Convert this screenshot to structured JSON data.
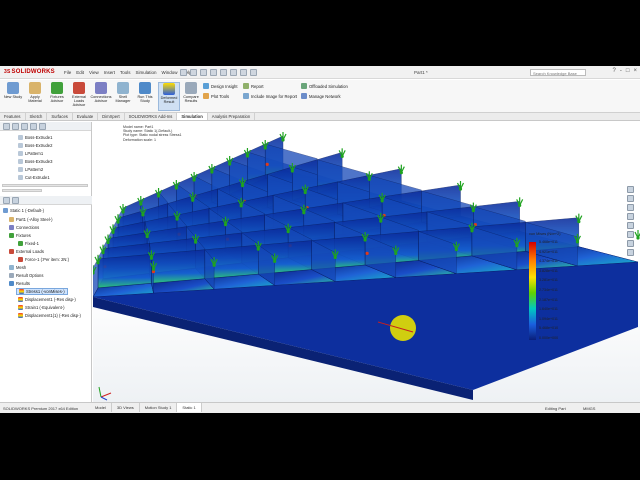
{
  "app": {
    "logo_prefix": "3S",
    "logo": "SOLIDWORKS",
    "title": "Part1 *",
    "search_placeholder": "Search Knowledge Base",
    "window_buttons": [
      "?",
      "-",
      "□",
      "×"
    ]
  },
  "menus": [
    "File",
    "Edit",
    "View",
    "Insert",
    "Tools",
    "Simulation",
    "Window",
    "Help"
  ],
  "commands": [
    {
      "label": "New Study"
    },
    {
      "label": "Apply Material"
    },
    {
      "label": "Fixtures Advisor"
    },
    {
      "label": "External Loads Advisor"
    },
    {
      "label": "Connections Advisor"
    },
    {
      "label": "Shell Manager"
    },
    {
      "label": "Run This Study"
    },
    {
      "label": "Results Advisor"
    },
    {
      "label": "Deformed Result"
    },
    {
      "label": "Compare Results"
    }
  ],
  "commands2": [
    "Design Insight",
    "Plot Tools",
    "Report",
    "Include Image for Report",
    "Offloaded Simulation",
    "Manage Network"
  ],
  "tabs": [
    "Features",
    "Sketch",
    "Surfaces",
    "Evaluate",
    "DimXpert",
    "SOLIDWORKS Add-Ins",
    "Simulation",
    "Analysis Preparation"
  ],
  "active_tab": "Simulation",
  "feature_tree": [
    "Boss-Extrude1",
    "Boss-Extrude2",
    "LPattern1",
    "Boss-Extrude3",
    "LPattern2",
    "Cut-Extrude1"
  ],
  "study_tree": {
    "study": "Static 1 (-Default-)",
    "part": "Part1 (-Alloy Steel-)",
    "connections": "Connections",
    "fixtures": "Fixtures",
    "fixture_item": "Fixed-1",
    "loads": "External Loads",
    "load_item": "Force-1 (:Per item: 2N:)",
    "mesh": "Mesh",
    "result_options": "Result Options",
    "results": "Results",
    "result_items": [
      "Stress1 (-vonMises-)",
      "Displacement1 (-Res disp-)",
      "Strain1 (-Equivalent-)",
      "Displacement1{1} (-Res disp-)"
    ]
  },
  "study_info": [
    "Model name: Part1",
    "Study name: Static 1(-Default-)",
    "Plot type: Static nodal stress Stress1",
    "Deformation scale: 1"
  ],
  "legend": {
    "title": "von Mises (N/m^2)",
    "values": [
      "5.468e+011",
      "4.921e+011",
      "4.374e+011",
      "3.828e+011",
      "3.281e+011",
      "2.734e+011",
      "2.187e+011",
      "1.640e+011",
      "1.094e+011",
      "5.468e+010",
      "0.000e+000"
    ],
    "colors": [
      "#d40000",
      "#ff7b00",
      "#ffe000",
      "#5fd000",
      "#00c9c0",
      "#1a5fe0",
      "#0a1f7a"
    ]
  },
  "status": {
    "left": "SOLIDWORKS Premium 2017 x64 Edition",
    "tabs": [
      "Model",
      "3D Views",
      "Motion Study 1",
      "Static 1"
    ],
    "active_tab": "Static 1",
    "editing": "Editing Part",
    "units": "MMGS"
  }
}
